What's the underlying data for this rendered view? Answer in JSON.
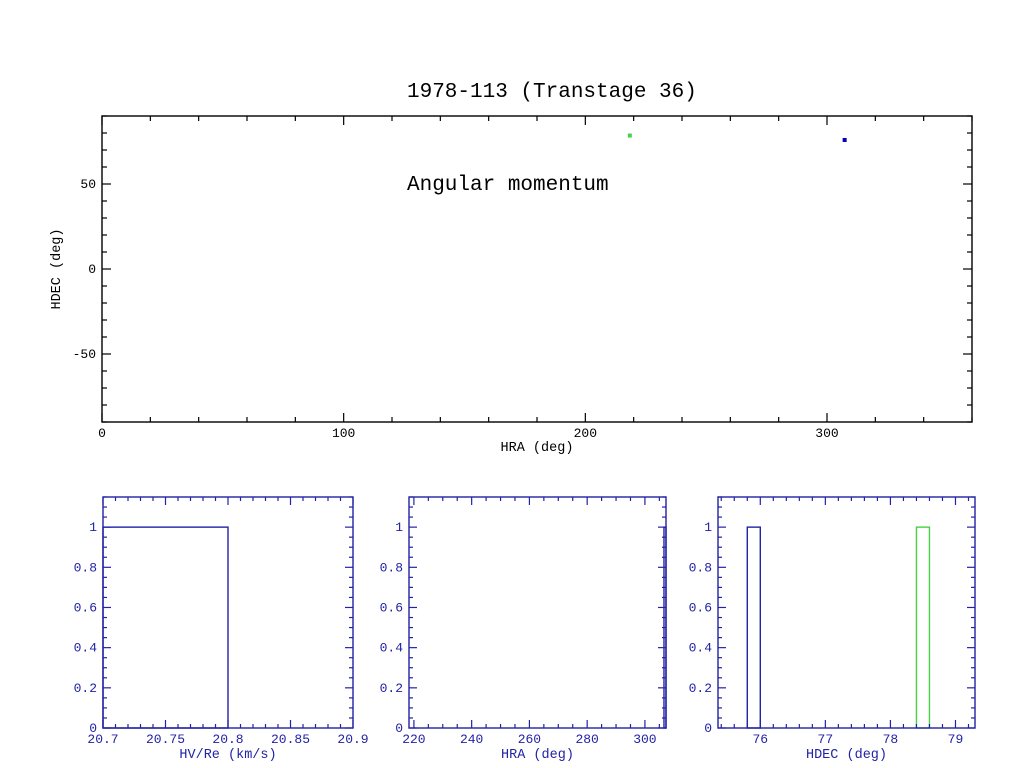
{
  "title": {
    "line1": "1978-113 (Transtage 36)",
    "line2": "Angular momentum"
  },
  "colors": {
    "black": "#000000",
    "navy": "#2222a6",
    "blue": "#0000b4",
    "green": "#46d246",
    "background": "#ffffff"
  },
  "chart_data": [
    {
      "id": "scatter-main",
      "type": "scatter",
      "xlabel": "HRA (deg)",
      "ylabel": "HDEC (deg)",
      "xlim": [
        0,
        360
      ],
      "ylim": [
        -90,
        90
      ],
      "xticks": {
        "major": [
          0,
          100,
          200,
          300
        ],
        "labels": [
          "0",
          "100",
          "200",
          "300"
        ],
        "minor_step": 20
      },
      "yticks": {
        "major": [
          -50,
          0,
          50
        ],
        "labels": [
          "-50",
          "0",
          "50"
        ],
        "minor_step": 10
      },
      "frame_color": "black",
      "points": [
        {
          "x": 218.4,
          "y": 78.5,
          "color": "green"
        },
        {
          "x": 307.3,
          "y": 75.9,
          "color": "blue"
        }
      ]
    },
    {
      "id": "hist-hvre",
      "type": "histogram",
      "xlabel": "HV/Re (km/s)",
      "xlim": [
        20.7,
        20.9
      ],
      "ylim": [
        0,
        1.15
      ],
      "xticks": {
        "major": [
          20.7,
          20.75,
          20.8,
          20.85,
          20.9
        ],
        "labels": [
          "20.7",
          "20.75",
          "20.8",
          "20.85",
          "20.9"
        ],
        "minor_step": 0.01
      },
      "yticks": {
        "major": [
          0,
          0.2,
          0.4,
          0.6,
          0.8,
          1
        ],
        "labels": [
          "0",
          "0.2",
          "0.4",
          "0.6",
          "0.8",
          "1"
        ],
        "minor_step": 0.05
      },
      "frame_color": "navy",
      "bars": [
        {
          "x1": 20.7,
          "x2": 20.8,
          "height": 1,
          "color": "navy"
        }
      ]
    },
    {
      "id": "hist-hra",
      "type": "histogram",
      "xlabel": "HRA (deg)",
      "xlim": [
        218.3,
        307.3
      ],
      "ylim": [
        0,
        1.15
      ],
      "xticks": {
        "major": [
          220,
          240,
          260,
          280,
          300
        ],
        "labels": [
          "220",
          "240",
          "260",
          "280",
          "300"
        ],
        "minor_step": 5
      },
      "yticks": {
        "major": [
          0,
          0.2,
          0.4,
          0.6,
          0.8,
          1
        ],
        "labels": [
          "0",
          "0.2",
          "0.4",
          "0.6",
          "0.8",
          "1"
        ],
        "minor_step": 0.05
      },
      "frame_color": "navy",
      "bars": [
        {
          "x1": 306.6,
          "x2": 307.3,
          "height": 1,
          "color": "navy"
        }
      ]
    },
    {
      "id": "hist-hdec",
      "type": "histogram",
      "xlabel": "HDEC (deg)",
      "xlim": [
        75.35,
        79.3
      ],
      "ylim": [
        0,
        1.15
      ],
      "xticks": {
        "major": [
          76,
          77,
          78,
          79
        ],
        "labels": [
          "76",
          "77",
          "78",
          "79"
        ],
        "minor_step": 0.2
      },
      "yticks": {
        "major": [
          0,
          0.2,
          0.4,
          0.6,
          0.8,
          1
        ],
        "labels": [
          "0",
          "0.2",
          "0.4",
          "0.6",
          "0.8",
          "1"
        ],
        "minor_step": 0.05
      },
      "frame_color": "navy",
      "bars": [
        {
          "x1": 75.8,
          "x2": 76.0,
          "height": 1,
          "color": "navy"
        },
        {
          "x1": 78.4,
          "x2": 78.6,
          "height": 1,
          "color": "green"
        }
      ]
    }
  ]
}
